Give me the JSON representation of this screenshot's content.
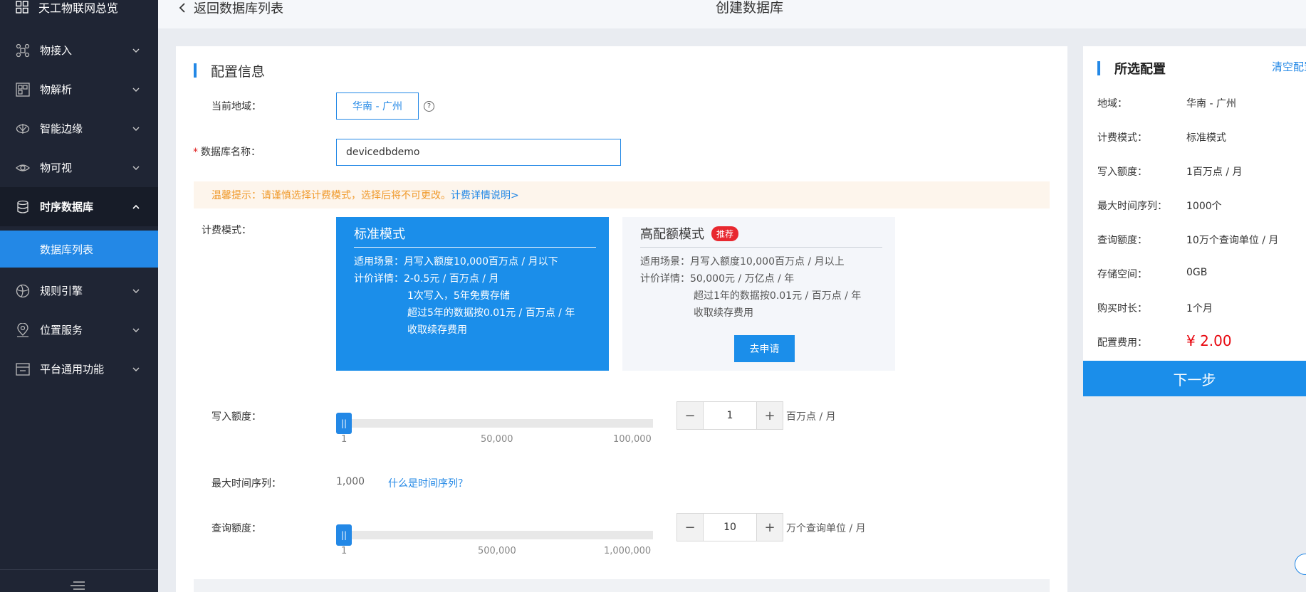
{
  "sidebar": {
    "overview": "天工物联网总览",
    "items": [
      {
        "label": "物接入",
        "icon": "device-access-icon"
      },
      {
        "label": "物解析",
        "icon": "device-parse-icon"
      },
      {
        "label": "智能边缘",
        "icon": "edge-icon"
      },
      {
        "label": "物可视",
        "icon": "eye-icon"
      },
      {
        "label": "时序数据库",
        "icon": "database-icon"
      },
      {
        "label": "规则引擎",
        "icon": "rule-engine-icon"
      },
      {
        "label": "位置服务",
        "icon": "location-icon"
      },
      {
        "label": "平台通用功能",
        "icon": "platform-icon"
      }
    ],
    "sub_item": "数据库列表"
  },
  "topbar": {
    "back_label": "返回数据库列表",
    "title": "创建数据库"
  },
  "config": {
    "section_title": "配置信息",
    "region_label": "当前地域：",
    "region_value": "华南 - 广州",
    "help": "?",
    "name_required_mark": "*",
    "name_label": "数据库名称：",
    "name_value": "devicedbdemo",
    "notice_warn": "温馨提示：请谨慎选择计费模式，选择后将不可更改。",
    "notice_link": "计费详情说明>",
    "billing_label": "计费模式：",
    "standard": {
      "title": "标准模式",
      "line1": "适用场景：月写入额度10,000百万点 / 月以下",
      "line2": "计价详情：2-0.5元 / 百万点 / 月",
      "line3": "1次写入，5年免费存储",
      "line4": "超过5年的数据按0.01元 / 百万点 / 年",
      "line5": "收取续存费用"
    },
    "premium": {
      "title": "高配额模式",
      "badge": "推荐",
      "line1": "适用场景：月写入额度10,000百万点 / 月以上",
      "line2": "计价详情：50,000元 / 万亿点 / 年",
      "line3": "超过1年的数据按0.01元 / 百万点 / 年",
      "line4": "收取续存费用",
      "apply": "去申请"
    },
    "write": {
      "label": "写入额度：",
      "ticks": [
        "1",
        "50,000",
        "100,000"
      ],
      "value": "1",
      "unit": "百万点 / 月",
      "handle": "||",
      "level": 0
    },
    "series": {
      "label": "最大时间序列：",
      "value": "1,000",
      "link": "什么是时间序列？"
    },
    "query": {
      "label": "查询额度：",
      "ticks": [
        "1",
        "500,000",
        "1,000,000"
      ],
      "value": "10",
      "unit": "万个查询单位 / 月",
      "handle": "||",
      "level": 0
    },
    "minus": "−",
    "plus": "+"
  },
  "summary": {
    "title": "所选配置",
    "clear": "清空配置",
    "rows": [
      {
        "label": "地域：",
        "value": "华南 - 广州"
      },
      {
        "label": "计费模式：",
        "value": "标准模式"
      },
      {
        "label": "写入额度：",
        "value": "1百万点 / 月"
      },
      {
        "label": "最大时间序列：",
        "value": "1000个"
      },
      {
        "label": "查询额度：",
        "value": "10万个查询单位 / 月"
      },
      {
        "label": "存储空间：",
        "value": "0GB"
      },
      {
        "label": "购买时长：",
        "value": "1个月"
      }
    ],
    "fee_label": "配置费用：",
    "fee_value": "¥ 2.00",
    "next": "下一步"
  },
  "colors": {
    "accent": "#2388e6",
    "sidebar_bg": "#1f2534",
    "warning": "#f09a2c",
    "price": "#e8070f",
    "badge": "#e8282f"
  }
}
